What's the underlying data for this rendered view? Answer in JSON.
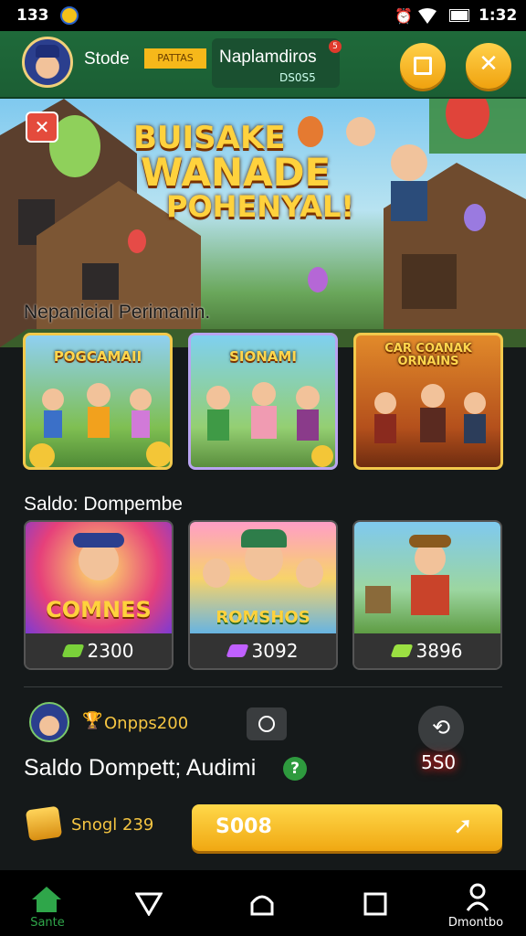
{
  "status_bar": {
    "time_left": "133",
    "time_right": "1:32"
  },
  "header": {
    "title": "Stode",
    "badge": "PATTAS",
    "account_name": "Naplamdiros",
    "account_id": "DS0S5",
    "notification_count": "5"
  },
  "banner": {
    "headline": [
      "BUISAKE",
      "WANADE",
      "POHENYAL!"
    ]
  },
  "sections": {
    "featured_title": "Nepanicial Perimanin.",
    "shop_title": "Saldo: Dompembe"
  },
  "featured_cards": [
    {
      "title": "POGCAMAII"
    },
    {
      "title": "SIONAMI"
    },
    {
      "title": "CAR COANAK ORNAINS"
    }
  ],
  "shop_items": [
    {
      "art_label": "COMNES",
      "price": "2300",
      "gem_color": "#7ad13a"
    },
    {
      "art_label": "ROMSHOS",
      "price": "3092",
      "gem_color": "#c060ff"
    },
    {
      "art_label": "",
      "price": "3896",
      "gem_color": "#9be042"
    }
  ],
  "wallet": {
    "points": "Onpps200",
    "balance_label": "Saldo Dompett; Audimi",
    "help_icon_text": "?",
    "sync_count": "5S0",
    "coins": "Snogl 239",
    "action_label": "S008"
  },
  "nav": {
    "home_label": "Sante",
    "profile_label": "Dmontbo"
  }
}
